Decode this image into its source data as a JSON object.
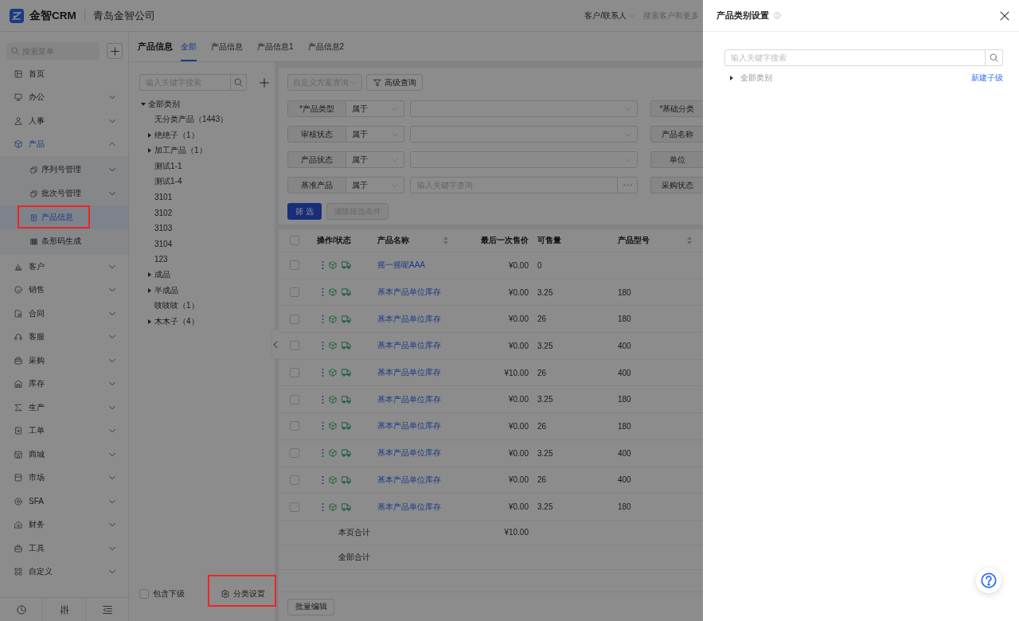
{
  "header": {
    "brand": "金智CRM",
    "company": "青岛金智公司",
    "search_scope": "客户/联系人",
    "search_placeholder": "搜索客户和更多"
  },
  "sidebar": {
    "search_placeholder": "搜索菜单",
    "items": [
      {
        "label": "首页",
        "selected": false
      },
      {
        "label": "办公",
        "selected": false,
        "expanded": false
      },
      {
        "label": "人事",
        "selected": false,
        "expanded": false
      },
      {
        "label": "产品",
        "selected": false,
        "expanded": true,
        "children": [
          {
            "label": "序列号管理",
            "selected": false,
            "expanded": false,
            "highlighted": false
          },
          {
            "label": "批次号管理",
            "selected": false,
            "expanded": false,
            "highlighted": false
          },
          {
            "label": "产品信息",
            "selected": true,
            "highlighted": true
          },
          {
            "label": "条形码生成",
            "selected": false,
            "highlighted": false
          }
        ]
      },
      {
        "label": "客户",
        "selected": false,
        "expanded": false
      },
      {
        "label": "销售",
        "selected": false,
        "expanded": false
      },
      {
        "label": "合同",
        "selected": false,
        "expanded": false
      },
      {
        "label": "客服",
        "selected": false,
        "expanded": false
      },
      {
        "label": "采购",
        "selected": false,
        "expanded": false
      },
      {
        "label": "库存",
        "selected": false,
        "expanded": false
      },
      {
        "label": "生产",
        "selected": false,
        "expanded": false
      },
      {
        "label": "工单",
        "selected": false,
        "expanded": false
      },
      {
        "label": "商城",
        "selected": false,
        "expanded": false
      },
      {
        "label": "市场",
        "selected": false,
        "expanded": false
      },
      {
        "label": "SFA",
        "selected": false,
        "expanded": false
      },
      {
        "label": "财务",
        "selected": false,
        "expanded": false
      },
      {
        "label": "工具",
        "selected": false,
        "expanded": false
      },
      {
        "label": "自定义",
        "selected": false,
        "expanded": false
      }
    ]
  },
  "page": {
    "title": "产品信息",
    "tabs": [
      {
        "label": "全部",
        "selected": true
      },
      {
        "label": "产品信息",
        "selected": false
      },
      {
        "label": "产品信息1",
        "selected": false
      },
      {
        "label": "产品信息2",
        "selected": false
      }
    ]
  },
  "category_panel": {
    "search_placeholder": "输入关键字搜索",
    "tree": [
      {
        "label": "全部类别",
        "expanded": true,
        "children": [
          {
            "label": "无分类产品（1443）"
          },
          {
            "label": "绝绝子（1）",
            "expanded": false
          },
          {
            "label": "加工产品（1）",
            "expanded": false
          },
          {
            "label": "测试1-1"
          },
          {
            "label": "测试1-4"
          },
          {
            "label": "3101"
          },
          {
            "label": "3102"
          },
          {
            "label": "3103"
          },
          {
            "label": "3104"
          },
          {
            "label": "123"
          },
          {
            "label": "成品",
            "expanded": false
          },
          {
            "label": "半成品",
            "expanded": false
          },
          {
            "label": "吱吱吱（1）"
          },
          {
            "label": "木木子（4）",
            "expanded": false
          }
        ]
      }
    ],
    "include_children": {
      "label": "包含下级",
      "checked": false
    },
    "settings_button": {
      "label": "分类设置",
      "highlighted": true
    }
  },
  "filters": {
    "scheme_placeholder": "自定义方案查询",
    "advanced_button": "高级查询",
    "rows": [
      {
        "kind": "select",
        "label": "*产品类型",
        "operator": "属于",
        "column_2_label": "*基础分类"
      },
      {
        "kind": "select",
        "label": "审核状态",
        "operator": "属于",
        "column_2_label": "产品名称"
      },
      {
        "kind": "select",
        "label": "产品状态",
        "operator": "属于",
        "column_2_label": "单位"
      },
      {
        "kind": "keyword",
        "label": "基准产品",
        "operator": "属于",
        "placeholder": "输入关键字查询",
        "column_2_label": "采购状态"
      }
    ],
    "apply_button": "筛 选",
    "clear_button": {
      "label": "清除筛选条件",
      "disabled": true
    }
  },
  "table": {
    "all_checked": false,
    "columns": [
      {
        "label": "操作/状态",
        "sortable": false
      },
      {
        "label": "产品名称",
        "sortable": true
      },
      {
        "label": "最后一次售价",
        "sortable": false
      },
      {
        "label": "可售量",
        "sortable": false
      },
      {
        "label": "产品型号",
        "sortable": true
      }
    ],
    "rows": [
      {
        "checked": false,
        "name": "摇一摇呢AAA",
        "last_price": "¥0.00",
        "available": "0"
      },
      {
        "checked": false,
        "name": "基本产品单位库存",
        "last_price": "¥0.00",
        "available": "3.25",
        "model": "180"
      },
      {
        "checked": false,
        "name": "基本产品单位库存",
        "last_price": "¥0.00",
        "available": "26",
        "model": "180"
      },
      {
        "checked": false,
        "name": "基本产品单位库存",
        "last_price": "¥0.00",
        "available": "3.25",
        "model": "400"
      },
      {
        "checked": false,
        "name": "基本产品单位库存",
        "last_price": "¥10.00",
        "available": "26",
        "model": "400"
      },
      {
        "checked": false,
        "name": "基本产品单位库存",
        "last_price": "¥0.00",
        "available": "3.25",
        "model": "180"
      },
      {
        "checked": false,
        "name": "基本产品单位库存",
        "last_price": "¥0.00",
        "available": "26",
        "model": "180"
      },
      {
        "checked": false,
        "name": "基本产品单位库存",
        "last_price": "¥0.00",
        "available": "3.25",
        "model": "400"
      },
      {
        "checked": false,
        "name": "基本产品单位库存",
        "last_price": "¥0.00",
        "available": "26",
        "model": "400"
      },
      {
        "checked": false,
        "name": "基本产品单位库存",
        "last_price": "¥0.00",
        "available": "3.25",
        "model": "180"
      }
    ],
    "summary": [
      {
        "label": "本页合计",
        "last_price": "¥10.00"
      },
      {
        "label": "全部合计"
      }
    ],
    "batch_edit_button": "批量编辑"
  },
  "drawer": {
    "title": "产品类别设置",
    "search_placeholder": "输入关键字搜索",
    "tree": [
      {
        "label": "全部类别",
        "expanded": false,
        "action": "新建子级"
      }
    ]
  }
}
